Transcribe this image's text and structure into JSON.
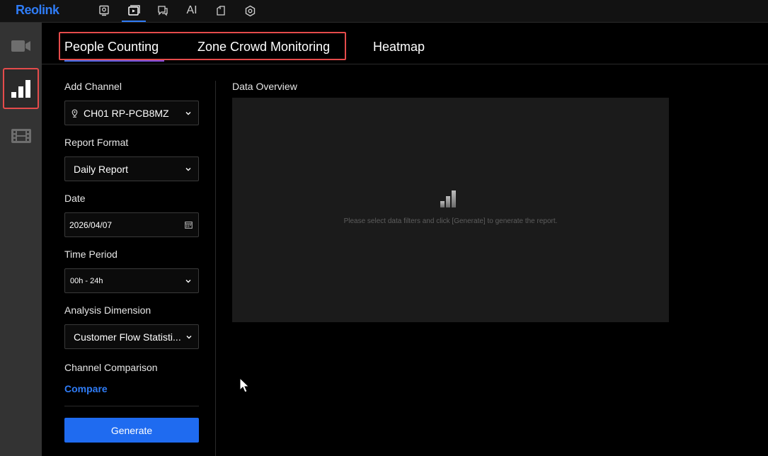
{
  "app": {
    "logo": "Reolink"
  },
  "topnav": {
    "ai_label": "AI"
  },
  "tabs": [
    {
      "label": "People Counting",
      "active": true
    },
    {
      "label": "Zone Crowd Monitoring",
      "active": false
    },
    {
      "label": "Heatmap",
      "active": false
    }
  ],
  "filters": {
    "add_channel": {
      "label": "Add Channel",
      "value": "CH01 RP-PCB8MZ"
    },
    "report_format": {
      "label": "Report Format",
      "value": "Daily Report"
    },
    "date": {
      "label": "Date",
      "value": "2026/04/07"
    },
    "time_period": {
      "label": "Time Period",
      "value": "00h - 24h"
    },
    "analysis_dimension": {
      "label": "Analysis Dimension",
      "value": "Customer Flow Statisti..."
    },
    "channel_comparison": {
      "label": "Channel Comparison",
      "link": "Compare"
    },
    "generate_label": "Generate"
  },
  "overview": {
    "title": "Data Overview",
    "empty_message": "Please select data filters and click [Generate] to generate the report."
  },
  "colors": {
    "accent": "#2f7cf6",
    "highlight": "#e54b4b",
    "button": "#1f6bf0"
  }
}
